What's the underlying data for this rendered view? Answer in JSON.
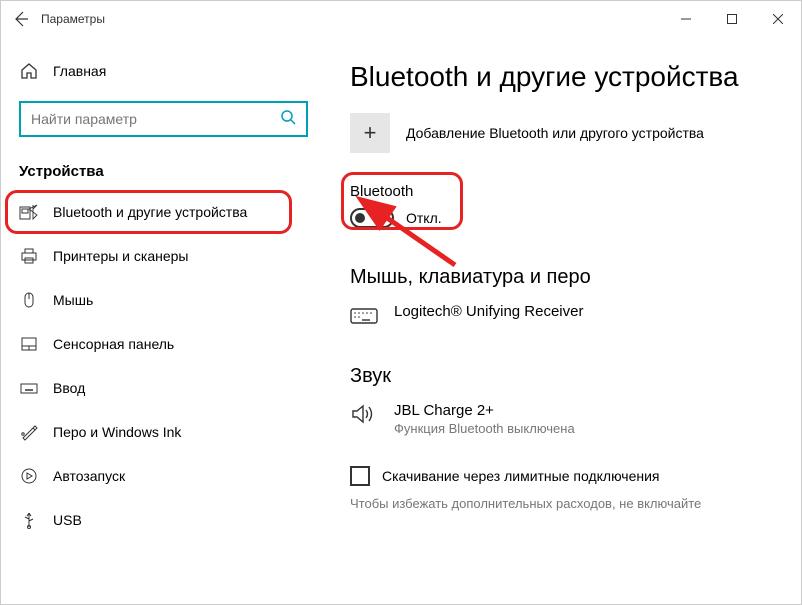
{
  "window": {
    "title": "Параметры",
    "home": "Главная",
    "search_placeholder": "Найти параметр",
    "category": "Устройства"
  },
  "sidebar": {
    "items": [
      {
        "label": "Bluetooth и другие устройства"
      },
      {
        "label": "Принтеры и сканеры"
      },
      {
        "label": "Мышь"
      },
      {
        "label": "Сенсорная панель"
      },
      {
        "label": "Ввод"
      },
      {
        "label": "Перо и Windows Ink"
      },
      {
        "label": "Автозапуск"
      },
      {
        "label": "USB"
      }
    ]
  },
  "main": {
    "heading": "Bluetooth и другие устройства",
    "add_label": "Добавление Bluetooth или другого устройства",
    "bt_section": "Bluetooth",
    "bt_state": "Откл.",
    "section_mouse": "Мышь, клавиатура и перо",
    "device_mouse": "Logitech® Unifying Receiver",
    "section_sound": "Звук",
    "device_sound": "JBL Charge 2+",
    "device_sound_sub": "Функция Bluetooth выключена",
    "metered_label": "Скачивание через лимитные подключения",
    "metered_note": "Чтобы избежать дополнительных расходов, не включайте"
  }
}
